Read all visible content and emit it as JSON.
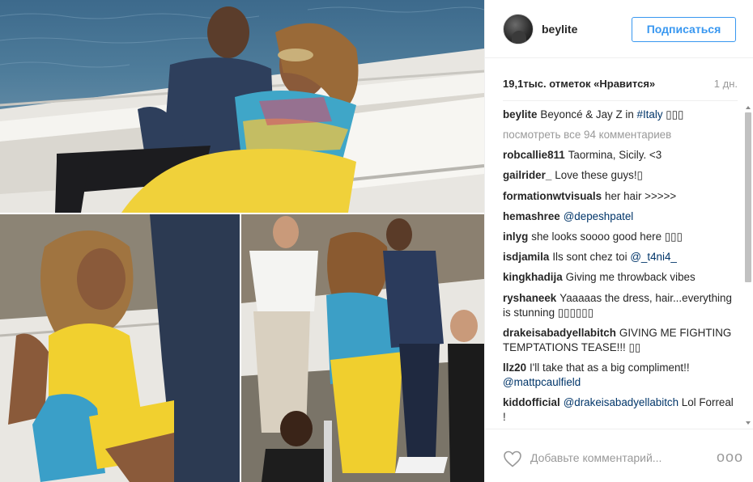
{
  "post": {
    "username": "beylite",
    "follow_label": "Подписаться",
    "likes": "19,1тыс. отметок «Нравится»",
    "time": "1 дн.",
    "view_all": "посмотреть все 94 комментариев",
    "add_comment_placeholder": "Добавьте комментарий...",
    "more_label": "ooo"
  },
  "caption": {
    "user": "beylite",
    "text": "Beyoncé & Jay Z in ",
    "tag": "#Italy",
    "emoji": " ▯▯▯"
  },
  "comments": [
    {
      "user": "robcallie811",
      "text": "Taormina, Sicily. <3"
    },
    {
      "user": "gailrider_",
      "text": "Love these guys!▯"
    },
    {
      "user": "formationwtvisuals",
      "text": "her hair >>>>>"
    },
    {
      "user": "hemashree",
      "text": "",
      "tag": "@depeshpatel"
    },
    {
      "user": "inlyg",
      "text": "she looks soooo good here ▯▯▯"
    },
    {
      "user": "isdjamila",
      "text": "Ils sont chez toi ",
      "tag": "@_t4ni4_"
    },
    {
      "user": "kingkhadija",
      "text": "Giving me throwback vibes"
    },
    {
      "user": "ryshaneek",
      "text": "Yaaaaas the dress, hair...everything is stunning ▯▯▯▯▯▯"
    },
    {
      "user": "drakeisabadyellabitch",
      "text": "GIVING ME FIGHTING TEMPTATIONS TEASE!!! ▯▯"
    },
    {
      "user": "llz20",
      "text": "I'll take that as a big compliment!! ",
      "tag": "@mattpcaulfield"
    },
    {
      "user": "kiddofficial",
      "text": "",
      "tag": "@drakeisabadyellabitch",
      "after": " Lol Forreal !"
    }
  ]
}
